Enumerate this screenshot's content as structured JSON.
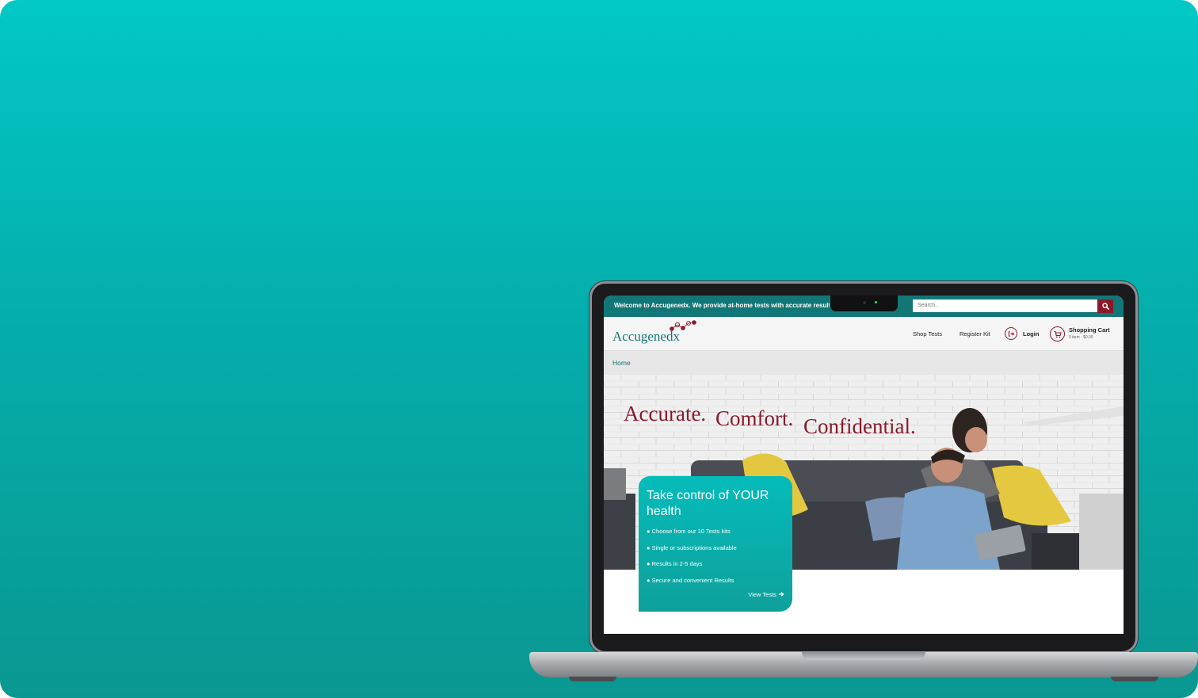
{
  "site": {
    "welcome_text": "Welcome to Accugenedx.  We provide at-home tests with accurate result",
    "search_placeholder": "Search..",
    "logo_text": "Accugenedx",
    "nav": {
      "shop_tests": "Shop Tests",
      "register_kit": "Register Kit",
      "login": "Login",
      "cart_label": "Shopping Cart",
      "cart_summary": "0 item - $0.00"
    },
    "breadcrumb": "Home",
    "hero": {
      "tag1": "Accurate.",
      "tag2": "Comfort.",
      "tag3": "Confidential."
    },
    "card": {
      "title": "Take control of YOUR health",
      "bullets": [
        "Choose from our 10 Tests kits",
        "Single or subscriptions available",
        "Results in 2-5 days",
        "Secure and convenient Results"
      ],
      "cta": "View Tests"
    }
  },
  "colors": {
    "brand_teal": "#117776",
    "brand_maroon": "#8a1a2b",
    "card_teal": "#04bcbb",
    "background_teal": "#02c8c6"
  },
  "icons": [
    "search-icon",
    "login-icon",
    "cart-icon",
    "arrow-right-icon",
    "logo-molecule-icon"
  ]
}
